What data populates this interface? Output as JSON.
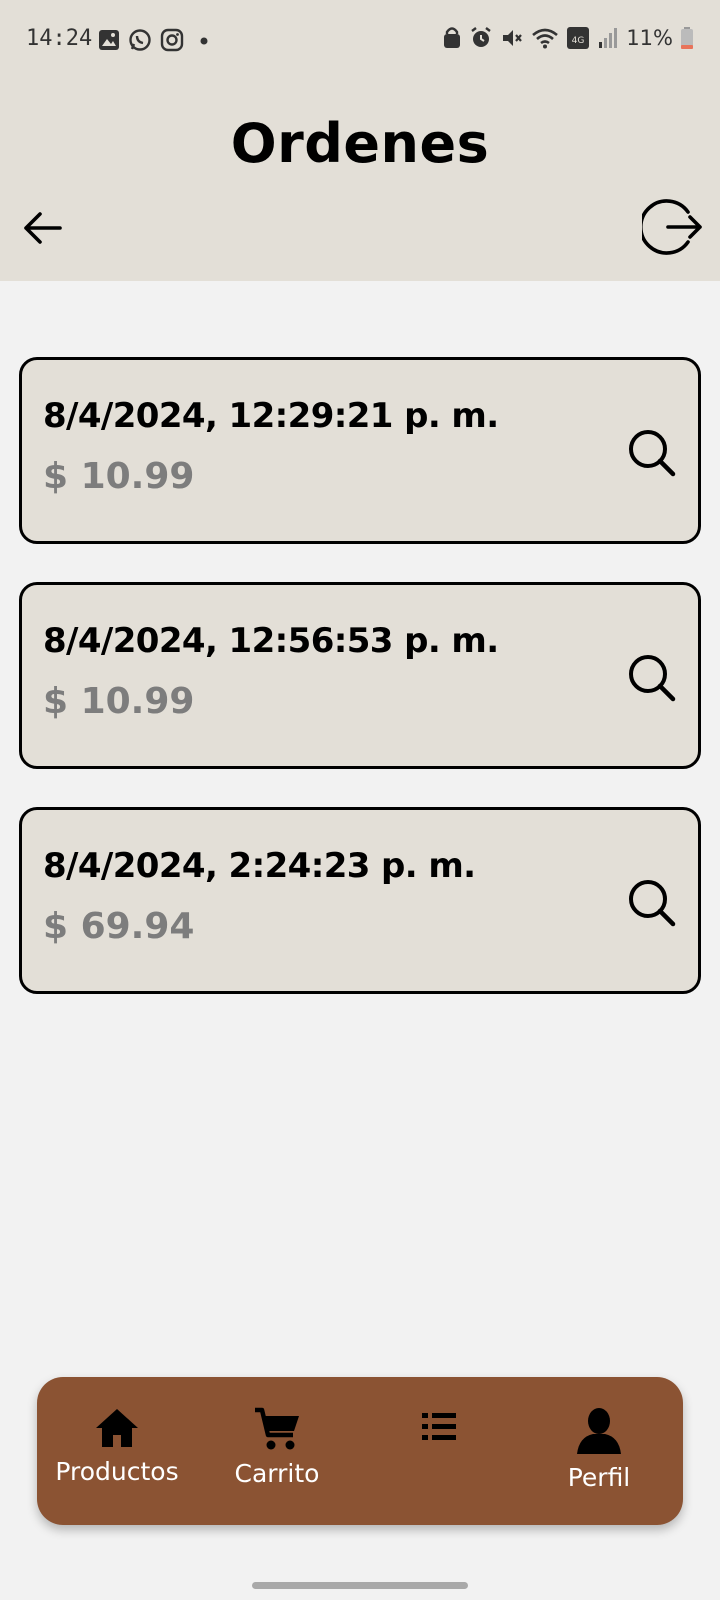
{
  "status_bar": {
    "time": "14:24",
    "battery": "11%",
    "network_badge": "4G"
  },
  "header": {
    "title": "Ordenes"
  },
  "orders": [
    {
      "date": "8/4/2024, 12:29:21 p. m.",
      "total": "$ 10.99"
    },
    {
      "date": "8/4/2024, 12:56:53 p. m.",
      "total": "$ 10.99"
    },
    {
      "date": "8/4/2024, 2:24:23 p. m.",
      "total": "$ 69.94"
    }
  ],
  "bottom_nav": {
    "items": [
      {
        "label": "Productos",
        "icon": "home-icon"
      },
      {
        "label": "Carrito",
        "icon": "cart-icon"
      },
      {
        "label": "",
        "icon": "list-icon"
      },
      {
        "label": "Perfil",
        "icon": "person-icon"
      }
    ]
  },
  "colors": {
    "header_bg": "#e3dfd7",
    "page_bg": "#f2f2f2",
    "card_bg": "#e3dfd7",
    "price_text": "#7d7d7d",
    "nav_bg": "#8b5333"
  }
}
